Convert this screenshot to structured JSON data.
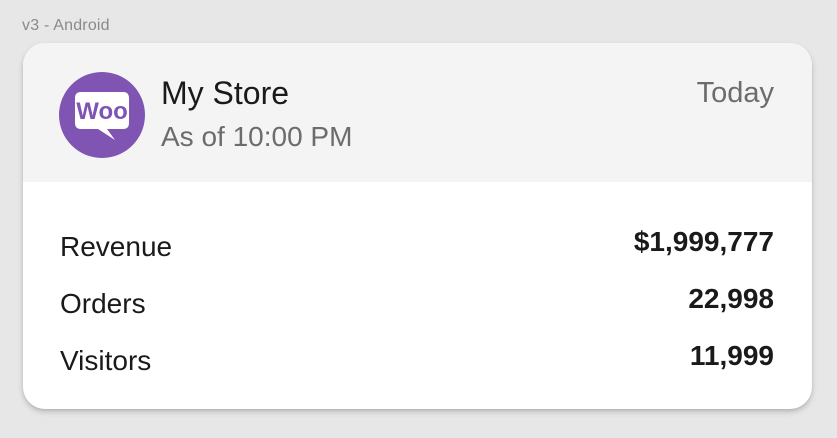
{
  "frame_label": "v3 - Android",
  "widget": {
    "logo_icon": "woocommerce-logo-icon",
    "logo_text": "Woo",
    "store_name": "My Store",
    "as_of": "As of 10:00 PM",
    "period": "Today",
    "brand_color": "#7f54b3",
    "stats": [
      {
        "label": "Revenue",
        "value": "$1,999,777"
      },
      {
        "label": "Orders",
        "value": "22,998"
      },
      {
        "label": "Visitors",
        "value": "11,999"
      }
    ]
  }
}
